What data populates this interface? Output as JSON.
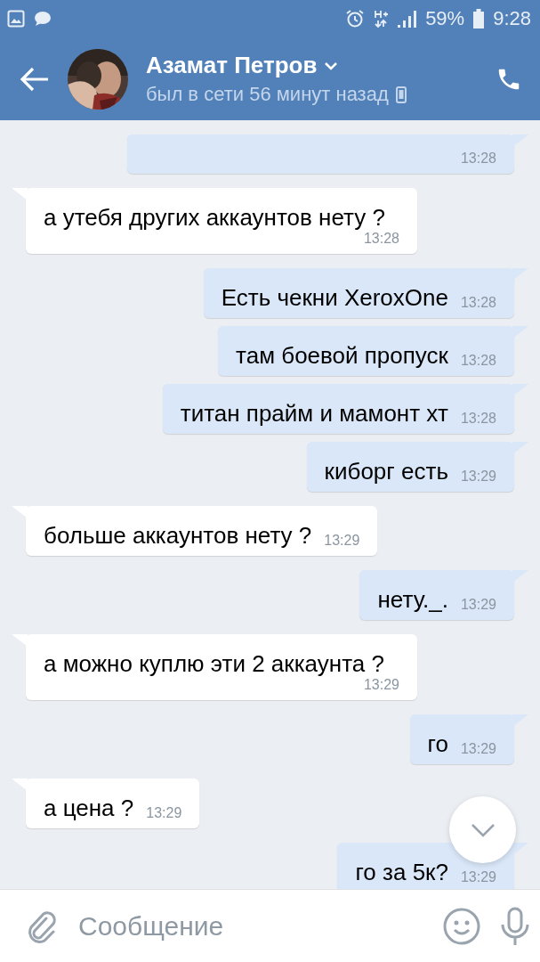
{
  "status_bar": {
    "battery": "59%",
    "time": "9:28"
  },
  "header": {
    "name": "Азамат Петров",
    "status": "был в сети 56 минут назад"
  },
  "messages": [
    {
      "kind": "outgoing",
      "time": "13:28"
    },
    {
      "kind": "incoming",
      "text": "а утебя других аккаунтов нету ?",
      "time": "13:28"
    },
    {
      "kind": "outgoing",
      "text": "Есть чекни  XeroxOne",
      "time": "13:28"
    },
    {
      "kind": "outgoing",
      "text": "там боевой пропуск",
      "time": "13:28"
    },
    {
      "kind": "outgoing",
      "text": "титан прайм и мамонт хт",
      "time": "13:28"
    },
    {
      "kind": "outgoing",
      "text": "киборг есть",
      "time": "13:29"
    },
    {
      "kind": "incoming",
      "text": "больше аккаунтов нету ?",
      "time": "13:29"
    },
    {
      "kind": "outgoing",
      "text": "нету._.",
      "time": "13:29"
    },
    {
      "kind": "incoming",
      "text": "а можно куплю эти 2 аккаунта ?",
      "time": "13:29"
    },
    {
      "kind": "outgoing",
      "text": "го",
      "time": "13:29"
    },
    {
      "kind": "incoming",
      "text": "а цена ?",
      "time": "13:29"
    },
    {
      "kind": "outgoing",
      "text": "го за 5к?",
      "time": "13:29"
    }
  ],
  "composer": {
    "placeholder": "Сообщение"
  }
}
